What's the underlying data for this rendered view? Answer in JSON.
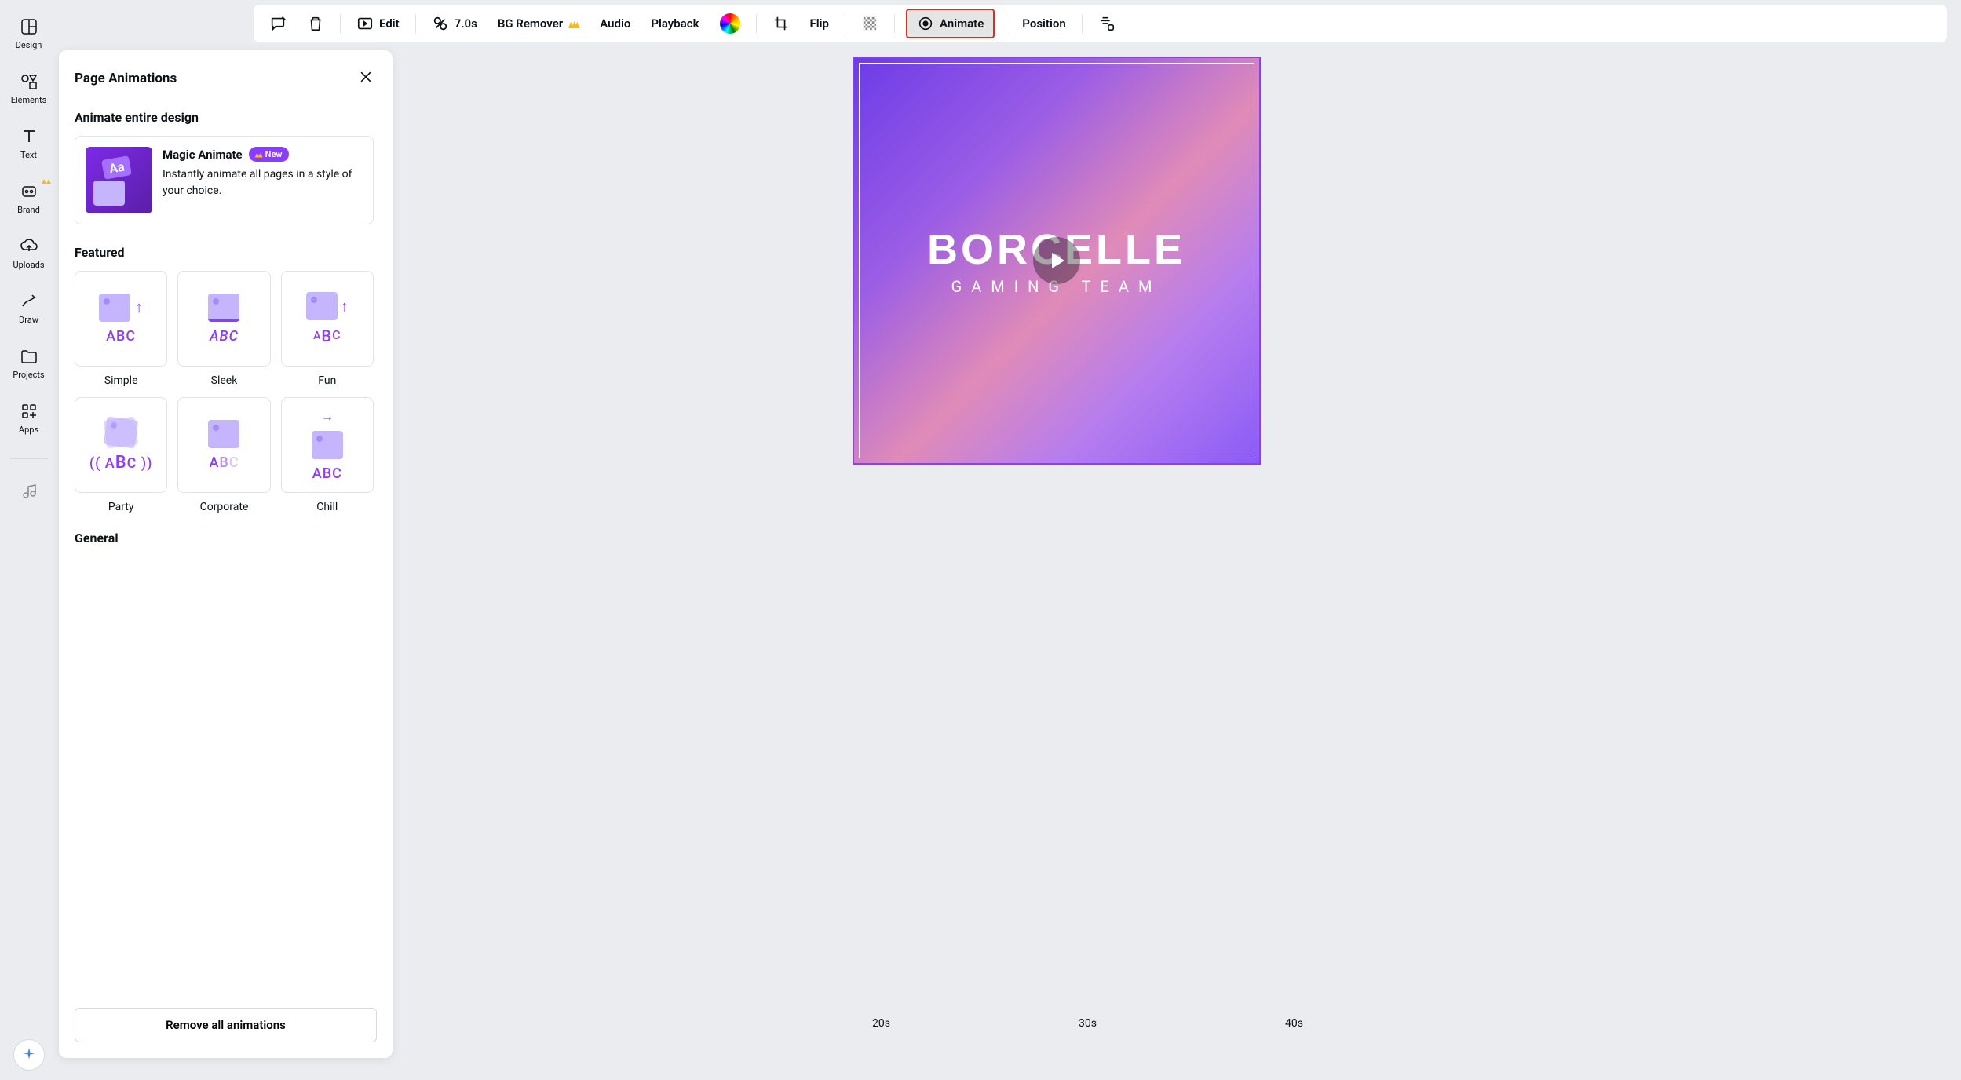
{
  "sidebar": {
    "items": [
      {
        "label": "Design"
      },
      {
        "label": "Elements"
      },
      {
        "label": "Text"
      },
      {
        "label": "Brand"
      },
      {
        "label": "Uploads"
      },
      {
        "label": "Draw"
      },
      {
        "label": "Projects"
      },
      {
        "label": "Apps"
      }
    ]
  },
  "toolbar": {
    "edit": "Edit",
    "duration": "7.0s",
    "bgremover": "BG Remover",
    "audio": "Audio",
    "playback": "Playback",
    "flip": "Flip",
    "animate": "Animate",
    "position": "Position"
  },
  "panel": {
    "title": "Page Animations",
    "section1": "Animate entire design",
    "magic": {
      "title": "Magic Animate",
      "badge": "New",
      "desc": "Instantly animate all pages in a style of your choice."
    },
    "featured_title": "Featured",
    "featured": [
      {
        "label": "Simple"
      },
      {
        "label": "Sleek"
      },
      {
        "label": "Fun"
      },
      {
        "label": "Party"
      },
      {
        "label": "Corporate"
      },
      {
        "label": "Chill"
      }
    ],
    "general_title": "General",
    "remove": "Remove all animations"
  },
  "canvas": {
    "title": "BORCELLE",
    "subtitle": "GAMING TEAM"
  },
  "timeline": {
    "marks": [
      "20s",
      "30s",
      "40s"
    ]
  }
}
